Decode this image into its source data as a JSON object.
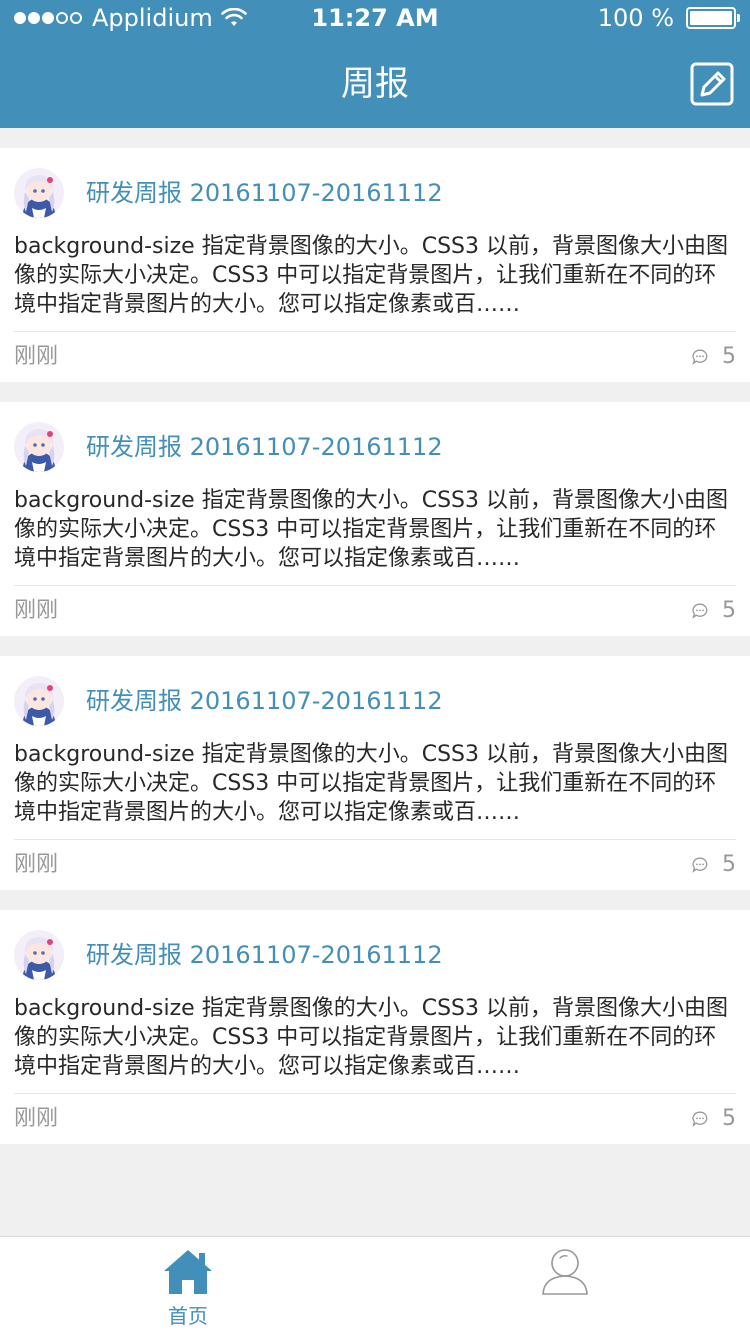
{
  "status_bar": {
    "carrier": "Applidium",
    "time": "11:27 AM",
    "battery": "100 %"
  },
  "nav": {
    "title": "周报",
    "edit_icon": "edit-icon"
  },
  "colors": {
    "brand": "#428fb9",
    "body_text": "#282828",
    "muted": "#989898"
  },
  "cards": [
    {
      "title": "研发周报 20161107-20161112",
      "body": "background-size 指定背景图像的大小。CSS3 以前，背景图像大小由图像的实际大小决定。CSS3 中可以指定背景图片，让我们重新在不同的环境中指定背景图片的大小。您可以指定像素或百……",
      "time": "刚刚",
      "comments": "5"
    },
    {
      "title": "研发周报 20161107-20161112",
      "body": "background-size 指定背景图像的大小。CSS3 以前，背景图像大小由图像的实际大小决定。CSS3 中可以指定背景图片，让我们重新在不同的环境中指定背景图片的大小。您可以指定像素或百……",
      "time": "刚刚",
      "comments": "5"
    },
    {
      "title": "研发周报 20161107-20161112",
      "body": "background-size 指定背景图像的大小。CSS3 以前，背景图像大小由图像的实际大小决定。CSS3 中可以指定背景图片，让我们重新在不同的环境中指定背景图片的大小。您可以指定像素或百……",
      "time": "刚刚",
      "comments": "5"
    },
    {
      "title": "研发周报 20161107-20161112",
      "body": "background-size 指定背景图像的大小。CSS3 以前，背景图像大小由图像的实际大小决定。CSS3 中可以指定背景图片，让我们重新在不同的环境中指定背景图片的大小。您可以指定像素或百……",
      "time": "刚刚",
      "comments": "5"
    }
  ],
  "tabbar": {
    "items": [
      {
        "label": "首页",
        "icon": "home-icon",
        "active": true
      },
      {
        "label": "",
        "icon": "user-icon",
        "active": false
      }
    ]
  }
}
